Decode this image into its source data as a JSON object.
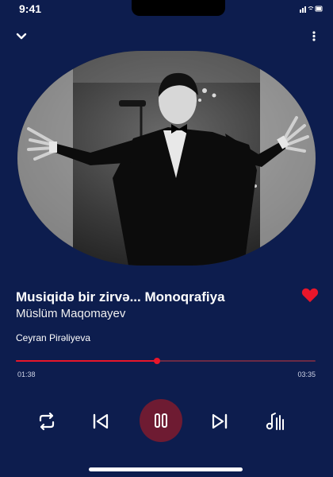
{
  "status_bar": {
    "time": "9:41"
  },
  "track": {
    "title": "Musiqidə bir zirvə... Monoqrafiya",
    "artist": "Müslüm Maqomayev",
    "narrator": "Ceyran Pirəliyeva"
  },
  "playback": {
    "elapsed": "01:38",
    "total": "03:35",
    "progress_fraction": 0.47,
    "state": "playing",
    "liked": true
  },
  "icons": {
    "collapse": "chevron-down-icon",
    "more": "vertical-ellipsis-icon",
    "like": "heart-icon",
    "repeat": "repeat-icon",
    "previous": "skip-previous-icon",
    "pause": "pause-icon",
    "next": "skip-next-icon",
    "playlist": "music-list-icon"
  },
  "colors": {
    "background": "#0d1d4e",
    "accent": "#e8162a",
    "play_button": "#6e1b32",
    "progress_track": "#6b2a45"
  }
}
